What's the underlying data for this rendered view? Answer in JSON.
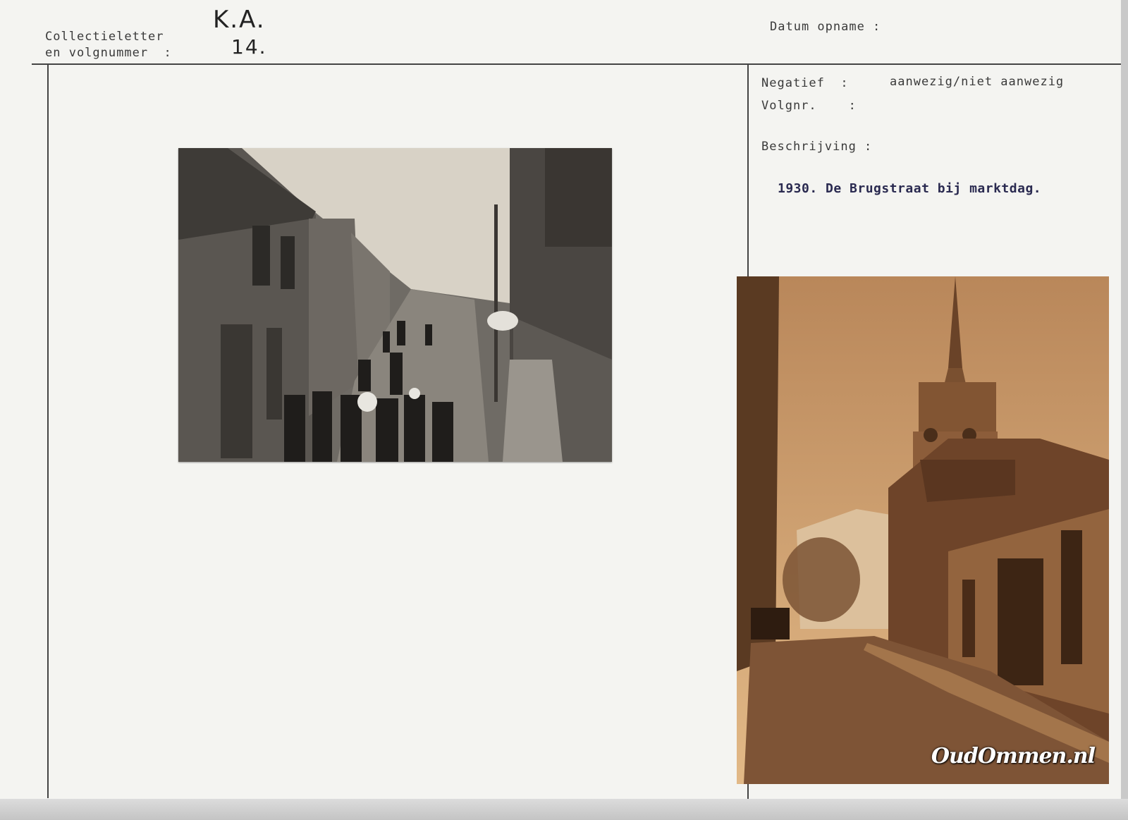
{
  "header": {
    "collection_label_line1": "Collectieletter",
    "collection_label_line2": "en volgnummer  :",
    "collection_letter": "K.A.",
    "collection_number": "14.",
    "date_label": "Datum opname :"
  },
  "right_panel": {
    "negative_label": "Negatief  :",
    "negative_value": "aanwezig/niet aanwezig",
    "volgnr_label": "Volgnr.    :",
    "description_label": "Beschrijving :",
    "description_text": "1930. De Brugstraat bij marktdag."
  },
  "photos": {
    "watermark": "OudOmmen.nl"
  }
}
